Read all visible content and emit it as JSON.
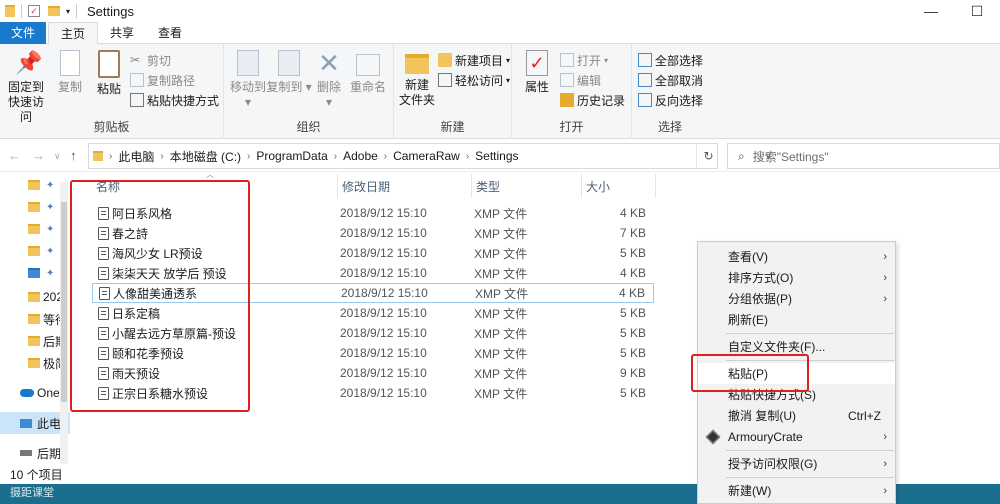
{
  "window": {
    "title": "Settings",
    "minimize": "—",
    "maximize": "☐"
  },
  "tabs": {
    "file": "文件",
    "home": "主页",
    "share": "共享",
    "view": "查看"
  },
  "ribbon": {
    "clipboard": {
      "label": "剪贴板",
      "pin": "固定到\n快速访问",
      "copy": "复制",
      "paste": "粘贴",
      "cut": "剪切",
      "copy_path": "复制路径",
      "paste_shortcut": "粘贴快捷方式"
    },
    "organize": {
      "label": "组织",
      "move_to": "移动到",
      "copy_to": "复制到",
      "delete": "删除",
      "rename": "重命名"
    },
    "new": {
      "label": "新建",
      "new_folder": "新建\n文件夹",
      "new_item": "新建项目",
      "easy_access": "轻松访问"
    },
    "open": {
      "label": "打开",
      "properties": "属性",
      "open": "打开",
      "edit": "编辑",
      "history": "历史记录"
    },
    "select": {
      "label": "选择",
      "select_all": "全部选择",
      "select_none": "全部取消",
      "invert": "反向选择"
    }
  },
  "address": {
    "crumbs": [
      "此电脑",
      "本地磁盘 (C:)",
      "ProgramData",
      "Adobe",
      "CameraRaw",
      "Settings"
    ],
    "search_placeholder": "搜索\"Settings\""
  },
  "navpane": {
    "items": [
      "",
      "",
      "",
      "",
      "",
      "202",
      "等待",
      "后期",
      "极简",
      "One",
      "此电",
      "后期"
    ]
  },
  "columns": {
    "name": "名称",
    "date": "修改日期",
    "type": "类型",
    "size": "大小"
  },
  "files": [
    {
      "name": "阿日系风格",
      "date": "2018/9/12 15:10",
      "type": "XMP 文件",
      "size": "4 KB"
    },
    {
      "name": "春之詩",
      "date": "2018/9/12 15:10",
      "type": "XMP 文件",
      "size": "7 KB"
    },
    {
      "name": "海风少女 LR预设",
      "date": "2018/9/12 15:10",
      "type": "XMP 文件",
      "size": "5 KB"
    },
    {
      "name": "柒柒天天 放学后 预设",
      "date": "2018/9/12 15:10",
      "type": "XMP 文件",
      "size": "4 KB"
    },
    {
      "name": "人像甜美通透系",
      "date": "2018/9/12 15:10",
      "type": "XMP 文件",
      "size": "4 KB"
    },
    {
      "name": "日系定稿",
      "date": "2018/9/12 15:10",
      "type": "XMP 文件",
      "size": "5 KB"
    },
    {
      "name": "小醒去远方草原篇-预设",
      "date": "2018/9/12 15:10",
      "type": "XMP 文件",
      "size": "5 KB"
    },
    {
      "name": "颐和花季预设",
      "date": "2018/9/12 15:10",
      "type": "XMP 文件",
      "size": "5 KB"
    },
    {
      "name": "雨天预设",
      "date": "2018/9/12 15:10",
      "type": "XMP 文件",
      "size": "9 KB"
    },
    {
      "name": "正宗日系糖水预设",
      "date": "2018/9/12 15:10",
      "type": "XMP 文件",
      "size": "5 KB"
    }
  ],
  "status": {
    "count": "10 个项目"
  },
  "taskbar": {
    "text": "摄距课堂"
  },
  "context_menu": {
    "view": "查看(V)",
    "sort": "排序方式(O)",
    "group": "分组依据(P)",
    "refresh": "刷新(E)",
    "customize": "自定义文件夹(F)...",
    "paste": "粘贴(P)",
    "paste_shortcut": "粘贴快捷方式(S)",
    "undo": "撤消 复制(U)",
    "undo_shortcut": "Ctrl+Z",
    "armoury": "ArmouryCrate",
    "grant": "授予访问权限(G)",
    "new": "新建(W)"
  },
  "colors": {
    "accent": "#1979ca",
    "highlight": "#e0201e",
    "taskbar": "#1b6f8e"
  }
}
